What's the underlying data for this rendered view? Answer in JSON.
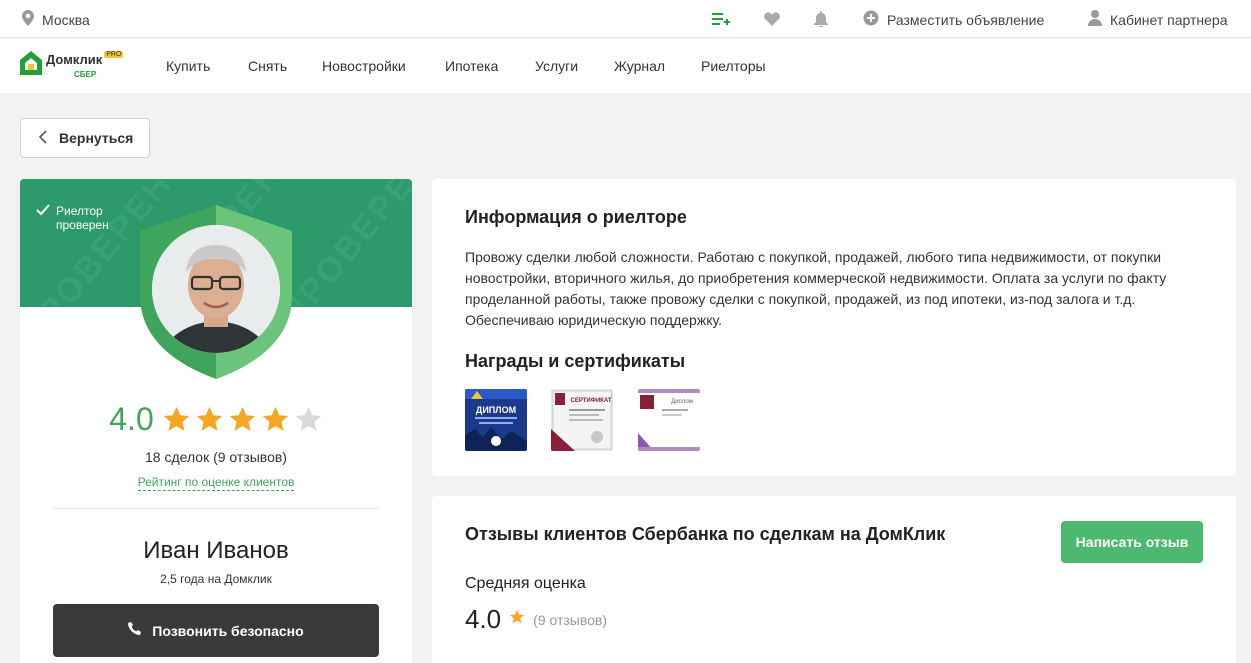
{
  "topbar": {
    "city": "Москва",
    "post_ad": "Разместить объявление",
    "partner_cabinet": "Кабинет партнера"
  },
  "logo": {
    "name": "Домклик",
    "pro": "PRO",
    "sber": "СБЕР"
  },
  "nav": [
    "Купить",
    "Снять",
    "Новостройки",
    "Ипотека",
    "Услуги",
    "Журнал",
    "Риелторы"
  ],
  "back_label": "Вернуться",
  "profile": {
    "verified_line1": "Риелтор",
    "verified_line2": "проверен",
    "watermark": "ПРОВЕРЕН",
    "rating": "4.0",
    "stars": 4,
    "stars_max": 5,
    "deals": "18 сделок (9 отзывов)",
    "rating_link": "Рейтинг по оценке клиентов",
    "name": "Иван Иванов",
    "years": "2,5 года на Домклик",
    "call_label": "Позвонить безопасно"
  },
  "info": {
    "title": "Информация о риелторе",
    "text": "Провожу сделки любой сложности. Работаю с покупкой, продажей, любого типа недвижимости, от покупки новостройки, вторичного жилья, до приобретения коммерческой недвижимости. Оплата за услуги по факту проделанной работы, также провожу сделки с покупкой, продажей, из под ипотеки, из-под залога и т.д. Обеспечиваю юридическую поддержку.",
    "awards_title": "Награды и сертификаты",
    "awards": [
      {
        "name": "diploma",
        "text": "ДИПЛОМ"
      },
      {
        "name": "certificate",
        "text": "СЕРТИФИКАТ"
      },
      {
        "name": "diploma-2",
        "text": "Диплом"
      }
    ]
  },
  "reviews": {
    "title": "Отзывы клиентов Сбербанка по сделкам на ДомКлик",
    "write_label": "Написать отзыв",
    "avg_label": "Средняя оценка",
    "avg_value": "4.0",
    "avg_count": "(9 отзывов)"
  },
  "colors": {
    "green": "#3fa55d",
    "banner": "#2c9a6a",
    "star": "#f5a623",
    "star_empty": "#d9d9d9",
    "button_dark": "#3a3a3a",
    "button_green": "#4db86f"
  }
}
